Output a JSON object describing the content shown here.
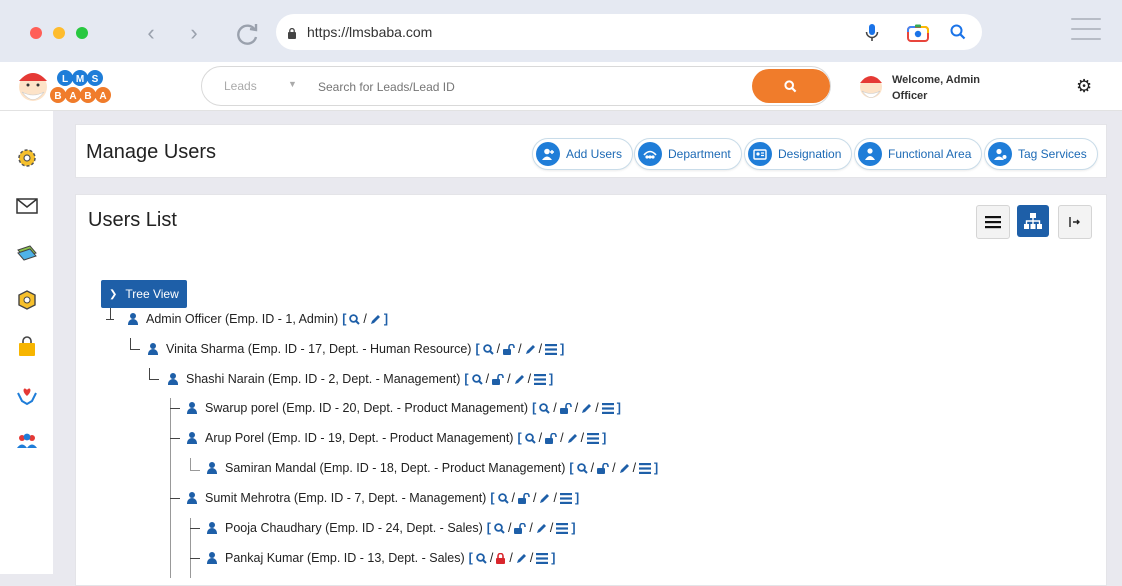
{
  "browser": {
    "url": "https://lmsbaba.com"
  },
  "header": {
    "logo_top": "LMS",
    "logo_bottom": "BABA",
    "search_select": "Leads",
    "search_placeholder": "Search for Leads/Lead ID",
    "welcome_line1": "Welcome, Admin",
    "welcome_line2": "Officer"
  },
  "manage": {
    "title": "Manage Users",
    "buttons": [
      "Add Users",
      "Department",
      "Designation",
      "Functional Area",
      "Tag Services"
    ]
  },
  "users_list": {
    "title": "Users List",
    "tree_view_label": "Tree View",
    "nodes": [
      {
        "text": "Admin Officer (Emp. ID - 1, Admin)"
      },
      {
        "text": "Vinita Sharma (Emp. ID - 17, Dept. - Human Resource)"
      },
      {
        "text": "Shashi Narain (Emp. ID - 2, Dept. - Management)"
      },
      {
        "text": "Swarup porel (Emp. ID - 20, Dept. - Product Management)"
      },
      {
        "text": "Arup Porel (Emp. ID - 19, Dept. - Product Management)"
      },
      {
        "text": "Samiran Mandal (Emp. ID - 18, Dept. - Product Management)"
      },
      {
        "text": "Sumit Mehrotra (Emp. ID - 7, Dept. - Management)"
      },
      {
        "text": "Pooja Chaudhary (Emp. ID - 24, Dept. - Sales)"
      },
      {
        "text": "Pankaj Kumar (Emp. ID - 13, Dept. - Sales)"
      }
    ]
  },
  "colors": {
    "primary": "#1e5fa8",
    "accent": "#f07c2b",
    "lock_red": "#d9262c"
  }
}
